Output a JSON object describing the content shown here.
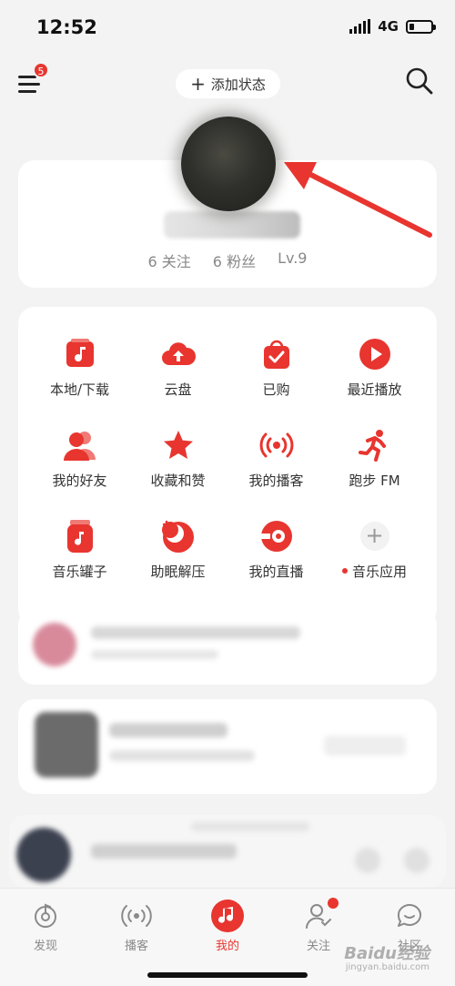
{
  "status_bar": {
    "time": "12:52",
    "network": "4G"
  },
  "header": {
    "menu_badge": "5",
    "add_status_label": "添加状态"
  },
  "profile": {
    "stats": [
      "6 关注",
      "6 粉丝",
      "Lv.9"
    ]
  },
  "grid": {
    "items": [
      {
        "label": "本地/下载",
        "icon": "music-file-icon"
      },
      {
        "label": "云盘",
        "icon": "cloud-upload-icon"
      },
      {
        "label": "已购",
        "icon": "shopping-bag-icon"
      },
      {
        "label": "最近播放",
        "icon": "play-icon"
      },
      {
        "label": "我的好友",
        "icon": "friends-icon"
      },
      {
        "label": "收藏和赞",
        "icon": "star-icon"
      },
      {
        "label": "我的播客",
        "icon": "podcast-icon"
      },
      {
        "label": "跑步 FM",
        "icon": "running-icon"
      },
      {
        "label": "音乐罐子",
        "icon": "music-jar-icon"
      },
      {
        "label": "助眠解压",
        "icon": "moon-icon"
      },
      {
        "label": "我的直播",
        "icon": "live-icon"
      },
      {
        "label": "音乐应用",
        "icon": "plus-icon"
      }
    ]
  },
  "bottom_nav": {
    "items": [
      {
        "label": "发现",
        "icon": "discover-icon"
      },
      {
        "label": "播客",
        "icon": "podcast-icon"
      },
      {
        "label": "我的",
        "icon": "music-note-icon"
      },
      {
        "label": "关注",
        "icon": "follow-icon"
      },
      {
        "label": "社区",
        "icon": "community-icon"
      }
    ],
    "active_index": 2
  },
  "watermark": {
    "text": "Baidu经验",
    "sub": "jingyan.baidu.com"
  },
  "colors": {
    "accent": "#e8352f",
    "background": "#f3f3f3",
    "card": "#ffffff",
    "text": "#333333",
    "muted": "#888888"
  }
}
